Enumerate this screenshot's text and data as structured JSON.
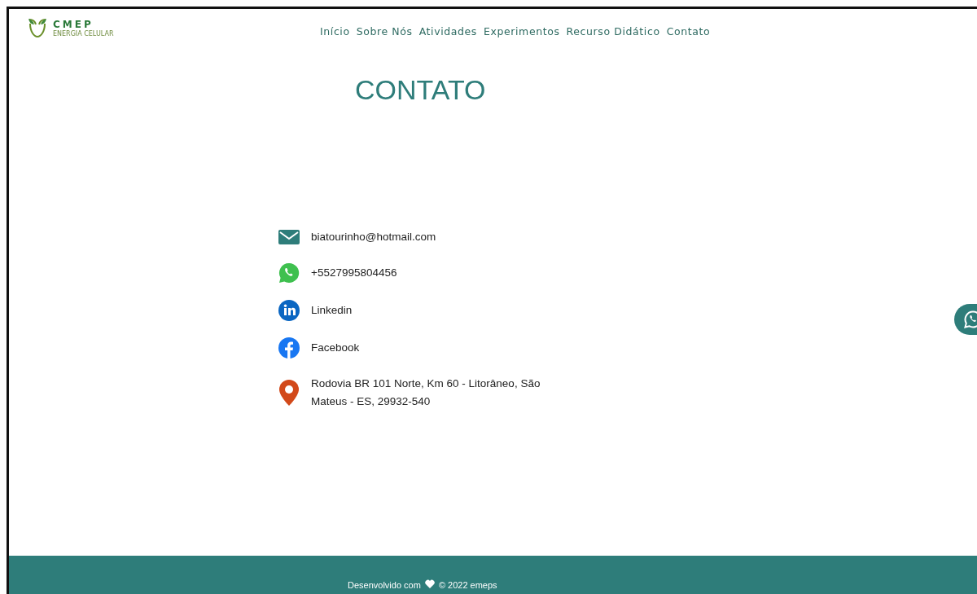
{
  "logo": {
    "title": "CMEP",
    "subtitle": "ENERGIA CELULAR"
  },
  "nav": [
    {
      "label": "Início"
    },
    {
      "label": "Sobre Nós"
    },
    {
      "label": "Atividades"
    },
    {
      "label": "Experimentos"
    },
    {
      "label": "Recurso Didático"
    },
    {
      "label": "Contato"
    }
  ],
  "heading": "CONTATO",
  "contacts": [
    {
      "kind": "email",
      "text": "biatourinho@hotmail.com"
    },
    {
      "kind": "whatsapp",
      "text": "+5527995804456"
    },
    {
      "kind": "linkedin",
      "text": "Linkedin"
    },
    {
      "kind": "facebook",
      "text": "Facebook"
    },
    {
      "kind": "location",
      "text": "Rodovia BR 101 Norte, Km 60 - Litorâneo, São Mateus - ES, 29932-540"
    }
  ],
  "footer": {
    "before": "Desenvolvido com",
    "after": "© 2022 emeps"
  }
}
